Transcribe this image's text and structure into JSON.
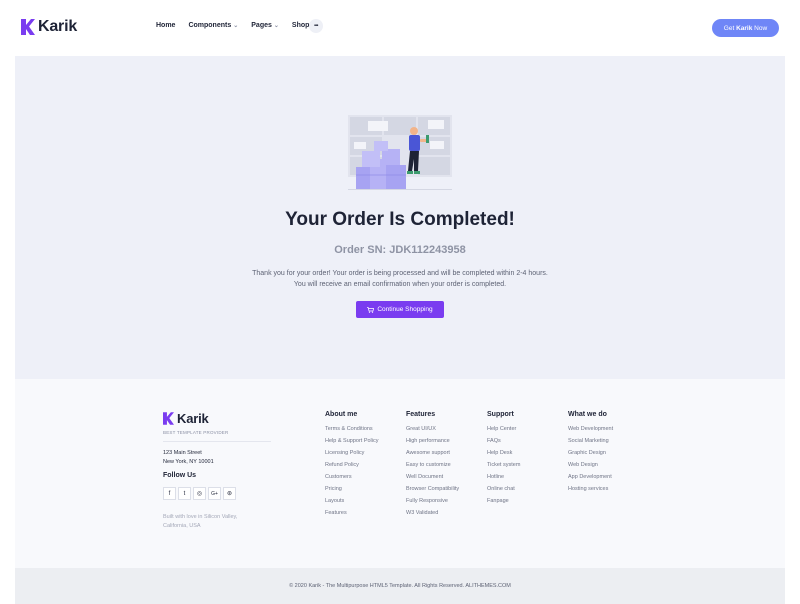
{
  "header": {
    "logo_text": "Karik",
    "nav": [
      {
        "label": "Home",
        "caret": false
      },
      {
        "label": "Components",
        "caret": true
      },
      {
        "label": "Pages",
        "caret": true
      },
      {
        "label": "Shop",
        "caret": true
      }
    ],
    "more_label": "•••",
    "cta": {
      "prefix": "Get",
      "brand": "Karik",
      "suffix": "Now"
    },
    "colors": {
      "accent": "#6f86f7",
      "logo": "#7a3cf0"
    }
  },
  "main": {
    "illustration": "delivery-man-with-boxes-illustration",
    "title": "Your Order Is Completed!",
    "order_sn_label": "Order SN:",
    "order_sn_value": "JDK112243958",
    "message_line1": "Thank you for your order! Your order is being processed and will be completed within 2-4 hours.",
    "message_line2": "You will receive an email confirmation when your order is completed.",
    "continue_label": "Continue Shopping",
    "continue_icon": "cart-icon",
    "button_color": "#7a3cf0"
  },
  "footer": {
    "logo_text": "Karik",
    "tagline": "BEST TEMPLATE PROVIDER",
    "address_line1": "123 Main Street",
    "address_line2": "New York, NY 10001",
    "follow_label": "Follow Us",
    "social": [
      {
        "icon": "facebook-icon",
        "glyph": "f"
      },
      {
        "icon": "twitter-icon",
        "glyph": "t"
      },
      {
        "icon": "instagram-icon",
        "glyph": "◎"
      },
      {
        "icon": "google-plus-icon",
        "glyph": "G+"
      },
      {
        "icon": "dribbble-icon",
        "glyph": "⊛"
      }
    ],
    "built_line1": "Built with love in Silicon Valley,",
    "built_line2": "California, USA",
    "columns": [
      {
        "title": "About me",
        "items": [
          "Terms & Conditions",
          "Help & Support Policy",
          "Licensing Policy",
          "Refund Policy",
          "Customers",
          "Pricing",
          "Layouts",
          "Features"
        ]
      },
      {
        "title": "Features",
        "items": [
          "Great UI/UX",
          "High performance",
          "Awesome support",
          "Easy to customize",
          "Well Document",
          "Browser Compatibility",
          "Fully Responsive",
          "W3 Validated"
        ]
      },
      {
        "title": "Support",
        "items": [
          "Help Center",
          "FAQs",
          "Help Desk",
          "Ticket system",
          "Hotline",
          "Online chat",
          "Fanpage"
        ]
      },
      {
        "title": "What we do",
        "items": [
          "Web Development",
          "Social Marketing",
          "Graphic Design",
          "Web Design",
          "App Development",
          "Hosting services"
        ]
      }
    ]
  },
  "bottom": {
    "copyright": "© 2020 Karik - The Multipurpose HTML5 Template. All Rights Reserved. ALITHEMES.COM"
  }
}
